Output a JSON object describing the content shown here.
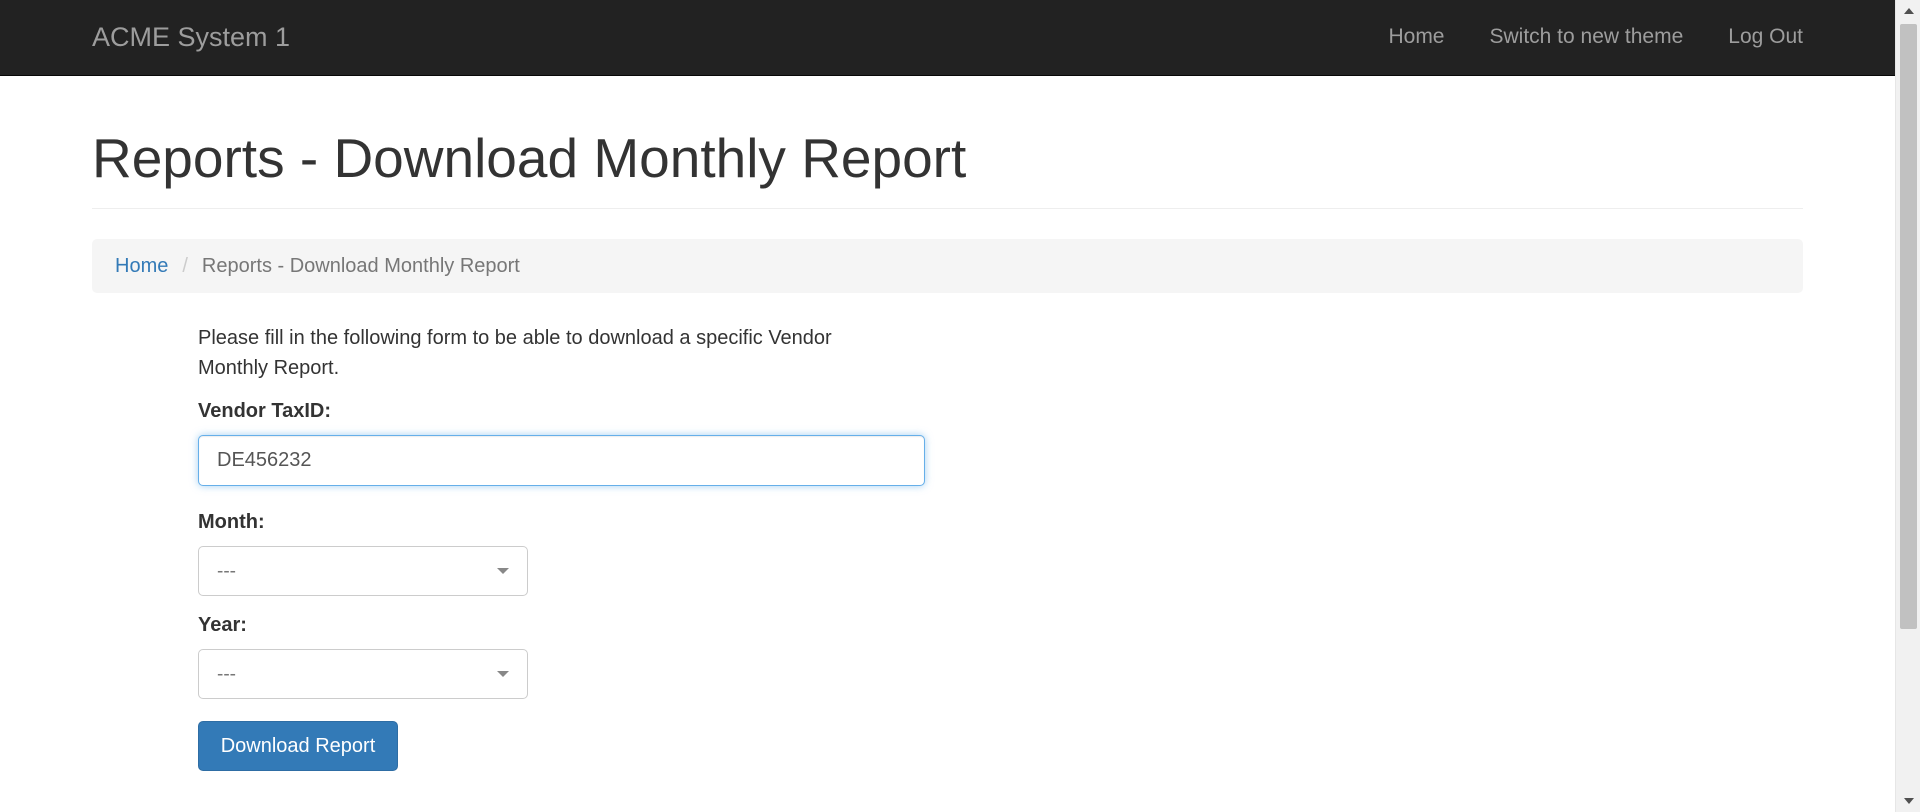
{
  "navbar": {
    "brand": "ACME System 1",
    "links": [
      "Home",
      "Switch to new theme",
      "Log Out"
    ]
  },
  "page": {
    "title": "Reports - Download Monthly Report"
  },
  "breadcrumb": {
    "home": "Home",
    "separator": "/",
    "current": "Reports - Download Monthly Report"
  },
  "form": {
    "intro": "Please fill in the following form to be able to download a specific Vendor Monthly Report.",
    "taxid_label": "Vendor TaxID:",
    "taxid_value": "DE456232",
    "month_label": "Month:",
    "month_value": "---",
    "year_label": "Year:",
    "year_value": "---",
    "submit_label": "Download Report"
  },
  "colors": {
    "navbar_bg": "#222222",
    "link": "#337ab7",
    "primary_button": "#337ab7",
    "focus_border": "#66afe9"
  }
}
